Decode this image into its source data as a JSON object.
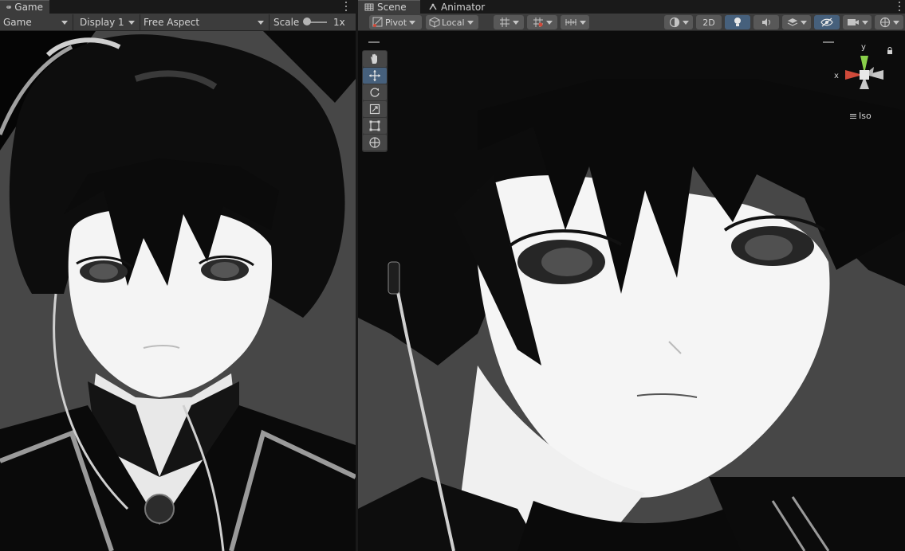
{
  "game_panel": {
    "tab_label": "Game",
    "toolbar": {
      "mode_label": "Game",
      "display_label": "Display 1",
      "aspect_label": "Free Aspect",
      "scale_label": "Scale",
      "scale_value": "1x",
      "scale_fraction": 0
    },
    "icons": {
      "tab": "gamepad-icon",
      "menu": "kebab-menu-icon"
    }
  },
  "scene_panel": {
    "tabs": [
      {
        "label": "Scene",
        "icon": "scene-grid-icon",
        "active": true
      },
      {
        "label": "Animator",
        "icon": "animator-icon",
        "active": false
      }
    ],
    "toolbar": {
      "pivot_label": "Pivot",
      "local_label": "Local",
      "mode_2d_label": "2D"
    },
    "tools": [
      {
        "name": "view-tool",
        "icon": "hand-icon",
        "selected": false
      },
      {
        "name": "move-tool",
        "icon": "move-arrows-icon",
        "selected": true
      },
      {
        "name": "rotate-tool",
        "icon": "rotate-icon",
        "selected": false
      },
      {
        "name": "scale-tool",
        "icon": "scale-icon",
        "selected": false
      },
      {
        "name": "rect-tool",
        "icon": "rect-transform-icon",
        "selected": false
      },
      {
        "name": "transform-tool",
        "icon": "transform-icon",
        "selected": false
      }
    ],
    "gizmo": {
      "y_label": "y",
      "x_label": "x",
      "projection_label": "Iso"
    }
  },
  "colors": {
    "panel_bg": "#3c3c3c",
    "tab_bar_bg": "#191919",
    "viewport_bg": "#474747",
    "active_blue": "#46607c",
    "axis_x": "#d04a3a",
    "axis_y": "#8ad04a"
  }
}
